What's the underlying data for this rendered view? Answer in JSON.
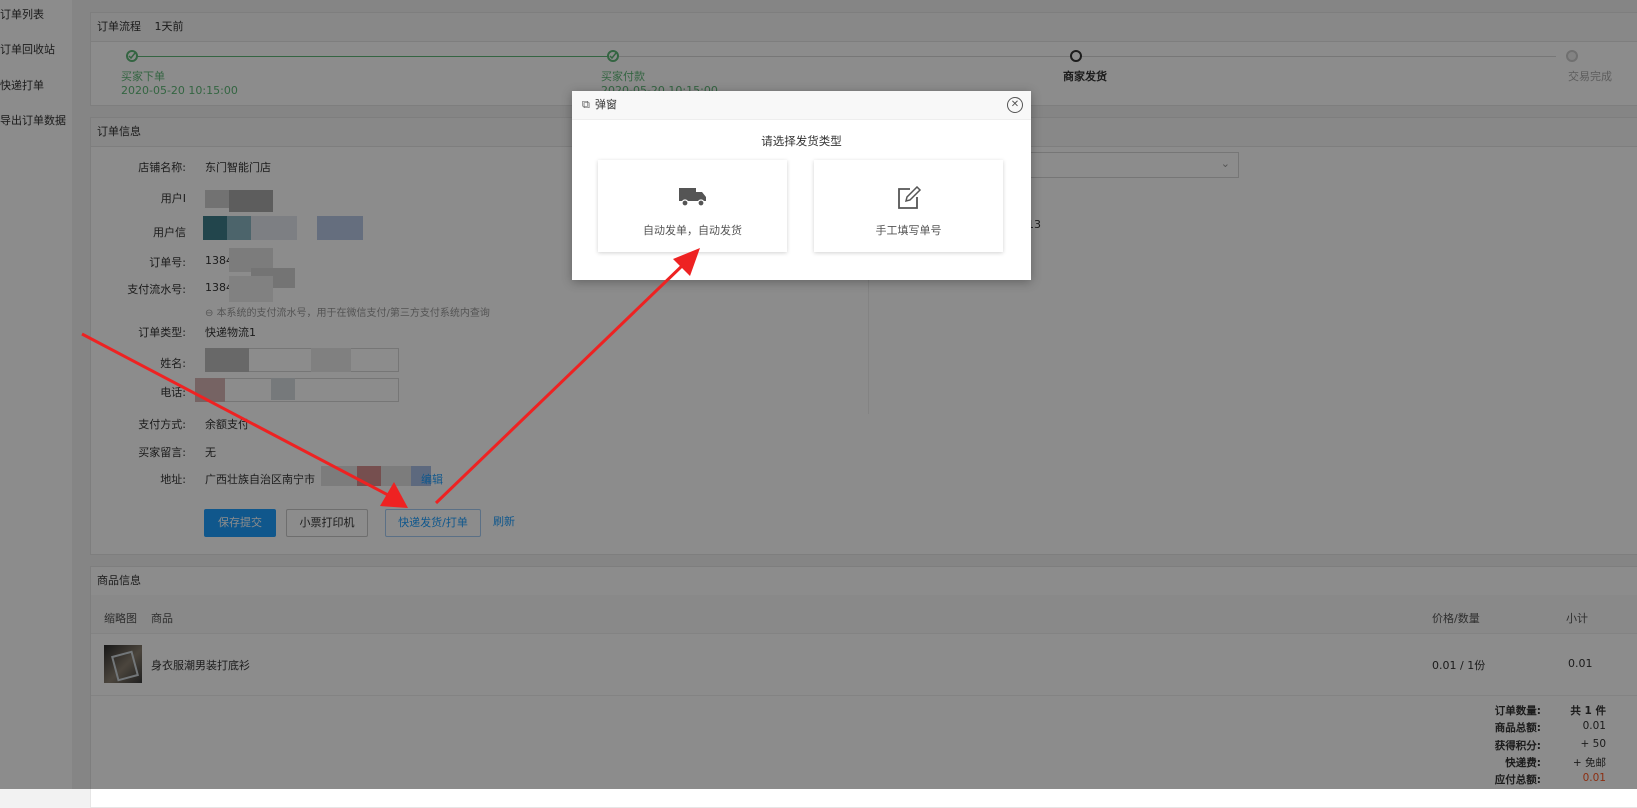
{
  "sidebar": {
    "items": [
      "订单列表",
      "订单回收站",
      "快递打单",
      "导出订单数据"
    ]
  },
  "flow": {
    "title": "订单流程",
    "ago": "1天前",
    "steps": [
      {
        "label": "买家下单",
        "time": "2020-05-20 10:15:00",
        "status": "done"
      },
      {
        "label": "买家付款",
        "time": "2020-05-20 10:15:00",
        "status": "done"
      },
      {
        "label": "商家发货",
        "time": "",
        "status": "current"
      },
      {
        "label": "交易完成",
        "time": "",
        "status": "pending"
      }
    ]
  },
  "order_info": {
    "title": "订单信息",
    "fields": {
      "shop_label": "店铺名称:",
      "shop_value": "东门智能门店",
      "user_label": "用户I",
      "userinfo_label": "用户信",
      "order_no_label": "订单号:",
      "order_no_value": "1384",
      "pay_no_label": "支付流水号:",
      "pay_no_value": "1384",
      "pay_no_hint": "本系统的支付流水号，用于在微信支付/第三方支付系统内查询",
      "order_type_label": "订单类型:",
      "order_type_value": "快递物流1",
      "name_label": "姓名:",
      "phone_label": "电话:",
      "pay_method_label": "支付方式:",
      "pay_method_value": "余额支付",
      "message_label": "买家留言:",
      "message_value": "无",
      "address_label": "地址:",
      "address_value": "广西壮族自治区南宁市",
      "address_edit": "编辑"
    },
    "right_value": "452813",
    "buttons": {
      "save": "保存提交",
      "receipt_print": "小票打印机",
      "express_print": "快递发货/打单",
      "refresh": "刷新"
    }
  },
  "goods": {
    "title": "商品信息",
    "headers": {
      "thumb": "缩略图",
      "name": "商品",
      "price_qty": "价格/数量",
      "subtotal": "小计"
    },
    "rows": [
      {
        "name": "身衣服潮男装打底衫",
        "price_qty": "0.01 / 1份",
        "subtotal": "0.01"
      }
    ],
    "summary": [
      {
        "label": "订单数量:",
        "value": "共 1 件"
      },
      {
        "label": "商品总额:",
        "value": "0.01"
      },
      {
        "label": "获得积分:",
        "value": "+ 50"
      },
      {
        "label": "快递费:",
        "value": "+ 免邮"
      },
      {
        "label": "应付总额:",
        "value": "0.01"
      }
    ]
  },
  "modal": {
    "title": "弹窗",
    "prompt": "请选择发货类型",
    "options": [
      {
        "label": "自动发单，自动发货",
        "icon": "truck-icon"
      },
      {
        "label": "手工填写单号",
        "icon": "edit-icon"
      }
    ]
  },
  "colors": {
    "done_green": "#5fb878",
    "primary_blue": "#1e9fff",
    "price_red": "#ff5722",
    "arrow_red": "#ee2222"
  }
}
